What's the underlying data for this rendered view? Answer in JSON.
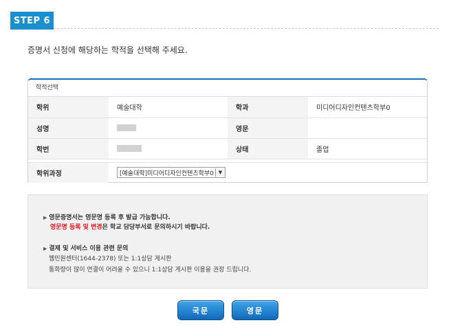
{
  "step": {
    "label": "STEP 6"
  },
  "instruction": "증명서 신청에 해당하는 학적을 선택해 주세요.",
  "panel": {
    "title": "학적선택",
    "rows": [
      {
        "l1": "학위",
        "v1": "예술대학",
        "l2": "학과",
        "v2": "미디어디자인컨텐츠학부0"
      },
      {
        "l1": "성명",
        "l2": "영문",
        "v2": ""
      },
      {
        "l1": "학번",
        "l2": "상태",
        "v2": "졸업"
      }
    ],
    "course_label": "학위과정",
    "course_select": "[예술대학]미디어디자인컨텐츠학부0"
  },
  "notice": {
    "line1": "영문증명서는 영문명 등록 후 발급 가능합니다.",
    "line2_red": "영문명 등록 및 변경",
    "line2_rest": "은 학교 담당부서로 문의하시기 바랍니다.",
    "line3": "결제 및 서비스 이용 관련 문의",
    "line4": "웹민원센터(1644-2378) 또는 1:1상담 게시판",
    "line5": "통화량이 많이 연결이 어려울 수 있으니 1:1상담 게시판 이용을 권장 드립니다."
  },
  "buttons": {
    "korean": "국문",
    "english": "영문"
  },
  "colors": {
    "accent": "#1a8fd0",
    "button": "#1168b8",
    "warning": "#e0141e"
  }
}
